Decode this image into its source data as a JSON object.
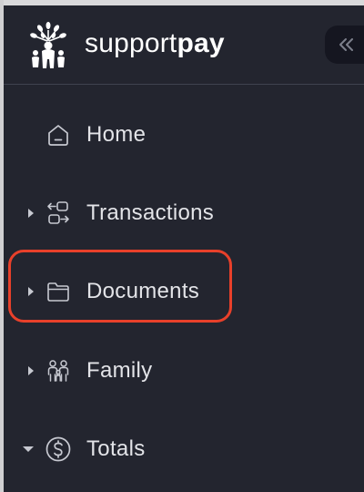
{
  "brand": {
    "name_regular": "support",
    "name_bold": "pay",
    "logo_icon": "tree-people-logo"
  },
  "header": {
    "collapse_icon": "double-chevron-left-icon"
  },
  "nav": {
    "items": [
      {
        "label": "Home",
        "icon": "home-icon",
        "expandable": false
      },
      {
        "label": "Transactions",
        "icon": "transactions-icon",
        "expandable": true,
        "expanded": false
      },
      {
        "label": "Documents",
        "icon": "folder-icon",
        "expandable": true,
        "expanded": false,
        "highlighted": true
      },
      {
        "label": "Family",
        "icon": "family-icon",
        "expandable": true,
        "expanded": false
      },
      {
        "label": "Totals",
        "icon": "dollar-circle-icon",
        "expandable": true,
        "expanded": true
      }
    ]
  },
  "colors": {
    "sidebar_bg": "#23252f",
    "text": "#e3e4e8",
    "icon": "#c7c9d1",
    "highlight": "#e8402a"
  }
}
